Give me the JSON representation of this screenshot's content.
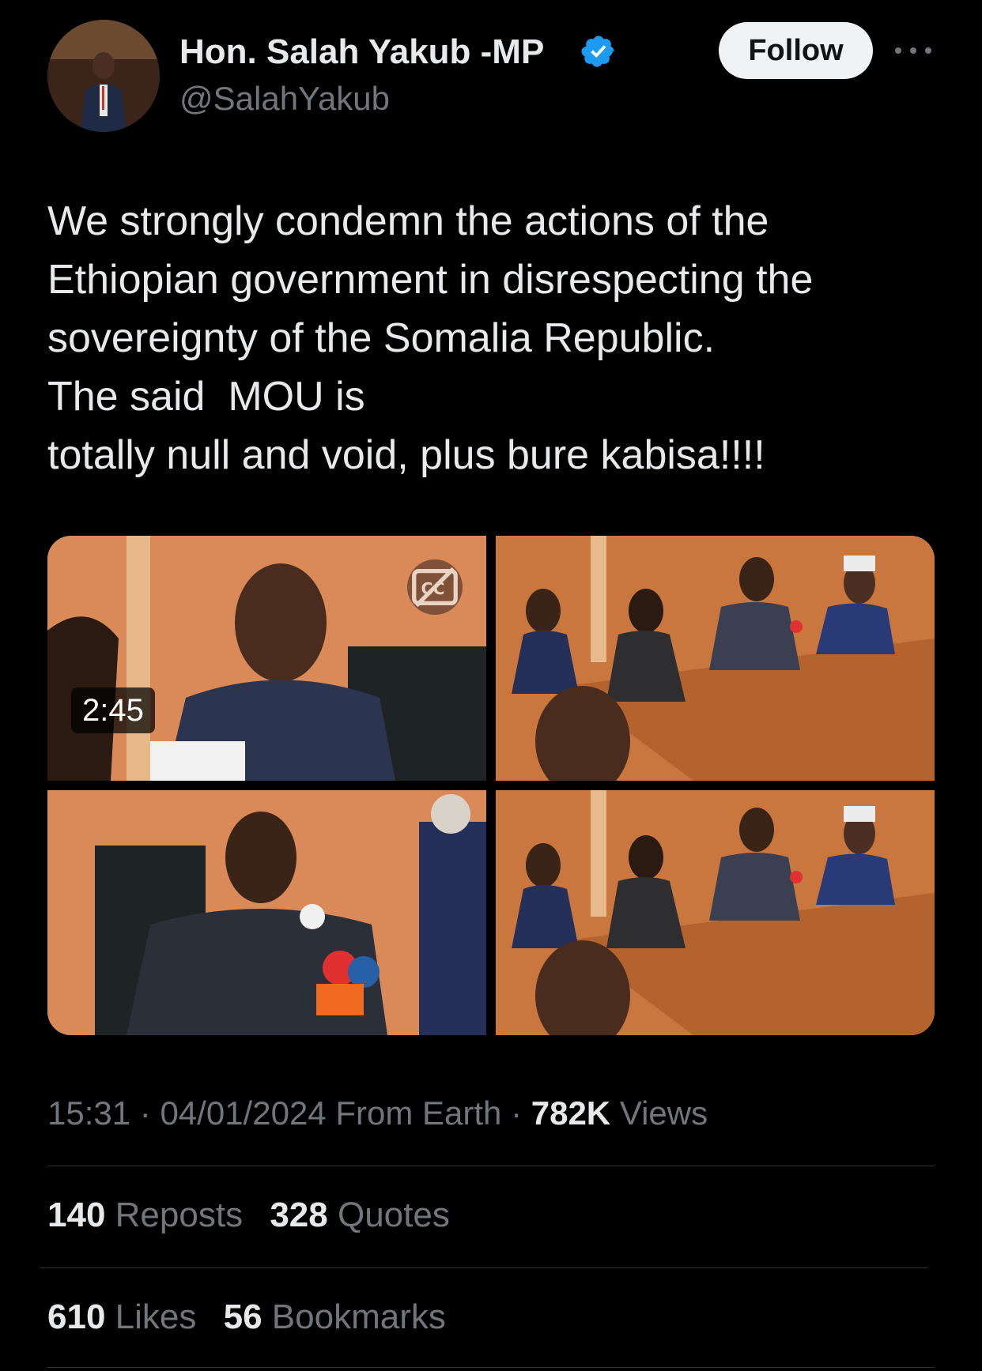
{
  "author": {
    "display_name": "Hon. Salah Yakub -MP",
    "handle": "@SalahYakub",
    "verified": true
  },
  "header": {
    "follow_label": "Follow"
  },
  "tweet": {
    "text": "We strongly condemn the actions of the\nEthiopian government in disrespecting the\nsovereignty of the Somalia Republic.\nThe said  MOU is\ntotally null and void, plus bure kabisa!!!!"
  },
  "media": {
    "video_duration": "2:45"
  },
  "meta": {
    "time": "15:31",
    "separator": "·",
    "date": "04/01/2024",
    "source": "From Earth",
    "views_count": "782K",
    "views_label": "Views"
  },
  "stats": {
    "reposts_count": "140",
    "reposts_label": "Reposts",
    "quotes_count": "328",
    "quotes_label": "Quotes",
    "likes_count": "610",
    "likes_label": "Likes",
    "bookmarks_count": "56",
    "bookmarks_label": "Bookmarks"
  },
  "colors": {
    "background": "#000000",
    "text_primary": "#e7e9ea",
    "text_secondary": "#71767b",
    "verified_blue": "#1d9bf0",
    "divider": "#2f3336"
  }
}
